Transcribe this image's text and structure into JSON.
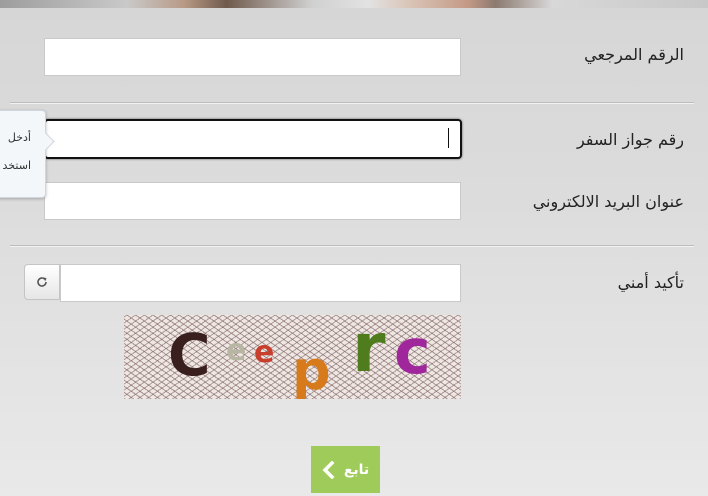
{
  "form": {
    "reference_number": {
      "label": "الرقم المرجعي",
      "value": ""
    },
    "passport_number": {
      "label": "رقم جواز السفر",
      "value": ""
    },
    "email": {
      "label": "عنوان البريد الالكتروني",
      "value": ""
    },
    "security_check": {
      "label": "تأكيد أمني",
      "value": ""
    }
  },
  "tooltip": {
    "line1": "أدخل",
    "line2": "استخد"
  },
  "captcha": {
    "text": "Ceeprc",
    "chars": [
      "C",
      "e",
      "e",
      "p",
      "r",
      "c"
    ]
  },
  "continue_button": {
    "label": "تابع"
  },
  "colors": {
    "button_green": "#9fcb5a",
    "captcha_dark": "#3a1f1f",
    "captcha_green": "#4f7d1e",
    "captcha_purple": "#a0269b",
    "captcha_orange": "#d77a1b"
  },
  "icons": {
    "refresh": "refresh-icon",
    "arrow": "chevron-left-icon"
  }
}
